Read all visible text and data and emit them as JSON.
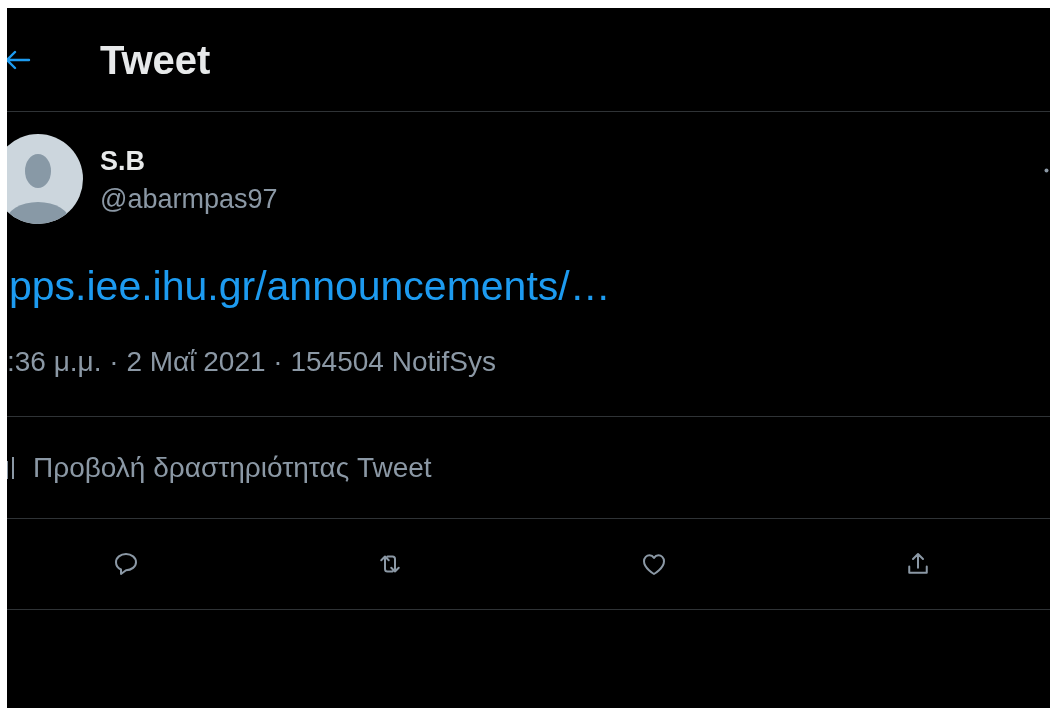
{
  "header": {
    "title": "Tweet"
  },
  "author": {
    "name": "S.B",
    "handle": "@abarmpas97"
  },
  "tweet": {
    "link": "pps.iee.ihu.gr/announcements/…",
    "meta": ":36 μ.μ. · 2 Μαΐ 2021 · 154504 NotifSys"
  },
  "activity": {
    "label": "Προβολή δραστηριότητας Tweet"
  },
  "actions": [
    {
      "kind": "reply"
    },
    {
      "kind": "retweet"
    },
    {
      "kind": "like"
    },
    {
      "kind": "share"
    }
  ]
}
